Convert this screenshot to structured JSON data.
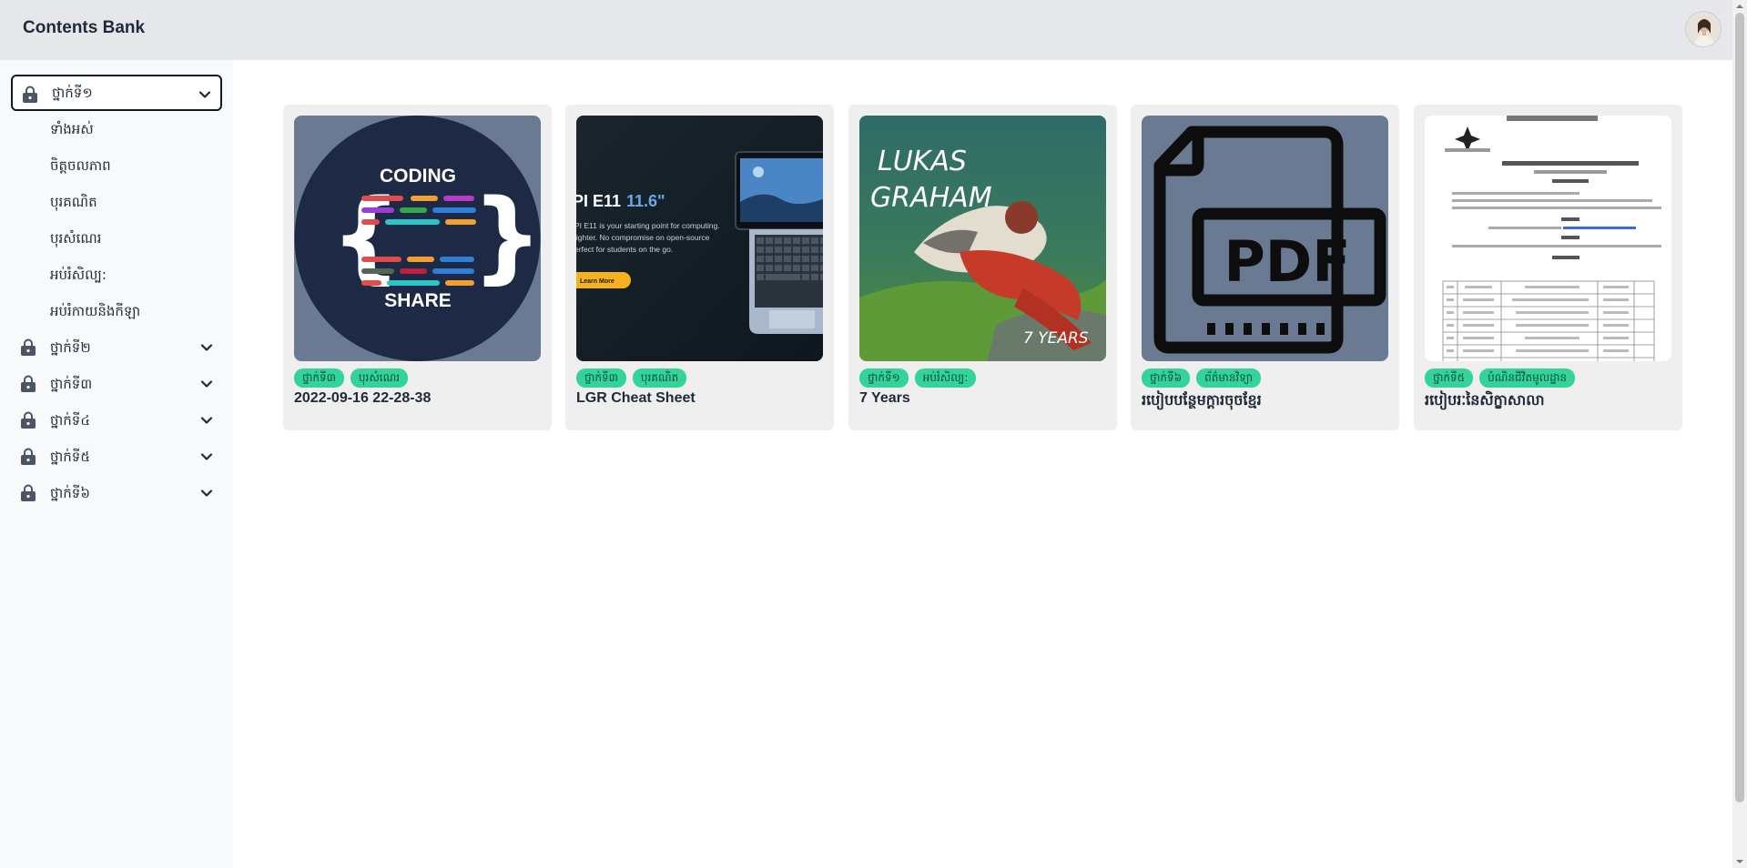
{
  "app": {
    "title": "Contents Bank"
  },
  "sidebar": {
    "grades": [
      {
        "label": "ថ្នាក់ទី១",
        "expanded": true
      },
      {
        "label": "ថ្នាក់ទី២"
      },
      {
        "label": "ថ្នាក់ទី៣"
      },
      {
        "label": "ថ្នាក់ទី៤"
      },
      {
        "label": "ថ្នាក់ទី៥"
      },
      {
        "label": "ថ្នាក់ទី៦"
      }
    ],
    "subjects": [
      "ទាំងអស់",
      "ចិត្តចលភាព",
      "បុរគណិត",
      "បុរសំណេរ",
      "អប់រំសិល្ប:",
      "អប់រំកាយនិងកីឡា"
    ]
  },
  "cards": [
    {
      "tags": [
        "ថ្នាក់ទី៣",
        "បុរសំណេរ"
      ],
      "title": "2022-09-16 22-28-38",
      "thumb_text": {
        "top": "CODING",
        "bottom": "SHARE"
      }
    },
    {
      "tags": [
        "ថ្នាក់ទី៣",
        "បុរគណិត"
      ],
      "title": "LGR Cheat Sheet",
      "thumb_text": {
        "heading": "PI E11",
        "size": "11.6\"",
        "line1": "PI E11 is your starting point for computing.",
        "line2": "lighter. No compromise on open-source",
        "line3": "erfect for students on the go.",
        "button": "Learn More"
      }
    },
    {
      "tags": [
        "ថ្នាក់ទី១",
        "អប់រំសិល្ប:"
      ],
      "title": "7 Years",
      "thumb_text": {
        "line1": "LUKAS",
        "line2": "GRAHAM",
        "corner": "7 YEARS"
      }
    },
    {
      "tags": [
        "ថ្នាក់ទី៦",
        "ព័ត៌មានវិទ្យា"
      ],
      "title": "របៀបបន្ថែមក្តារចុចខ្មែរ",
      "thumb_text": {
        "label": "PDF"
      }
    },
    {
      "tags": [
        "ថ្នាក់ទី៥",
        "បំណិនជីវិតមូលដ្ឋាន"
      ],
      "title": "របៀបរៈនៃសិក្ខាសាលា"
    }
  ],
  "colors": {
    "topbar": "#e5e7eb",
    "sidebar": "#f8f9fb",
    "card": "#efefef",
    "tag": "#34d399",
    "thumb_bg": "#6b7a93"
  }
}
